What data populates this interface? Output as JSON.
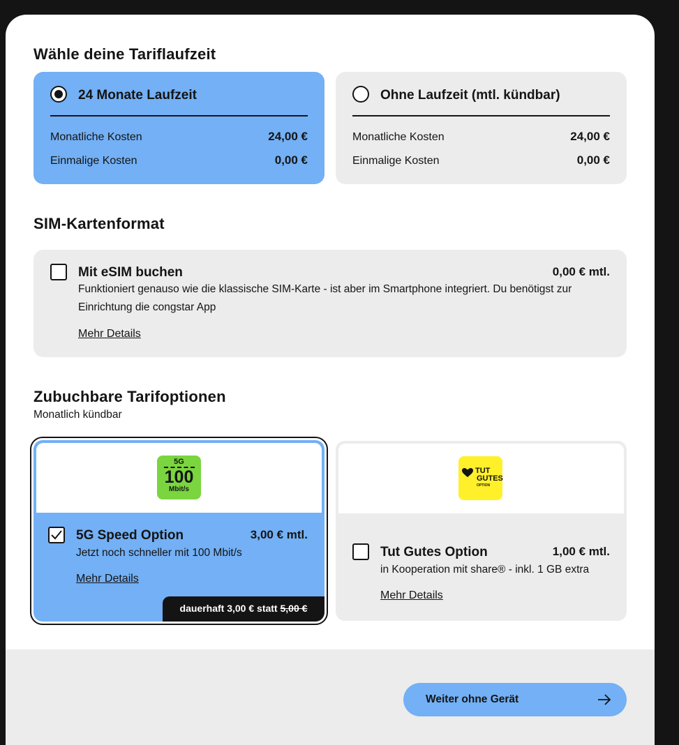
{
  "sections": {
    "duration_title": "Wähle deine Tariflaufzeit",
    "sim_title": "SIM-Kartenformat",
    "options_title": "Zubuchbare Tarifoptionen",
    "options_subtitle": "Monatlich kündbar"
  },
  "durations": [
    {
      "title": "24 Monate Laufzeit",
      "selected": true,
      "monthly_label": "Monatliche Kosten",
      "monthly_value": "24,00 €",
      "once_label": "Einmalige Kosten",
      "once_value": "0,00 €"
    },
    {
      "title": "Ohne Laufzeit (mtl. kündbar)",
      "selected": false,
      "monthly_label": "Monatliche Kosten",
      "monthly_value": "24,00 €",
      "once_label": "Einmalige Kosten",
      "once_value": "0,00 €"
    }
  ],
  "esim": {
    "title": "Mit eSIM buchen",
    "price": "0,00 € mtl.",
    "checked": false,
    "description_line1": "Funktioniert genauso wie die klassische SIM-Karte - ist aber im Smartphone integriert. Du benötigst zur",
    "description_line2": "Einrichtung die congstar App",
    "details_link": "Mehr Details"
  },
  "options": [
    {
      "title": "5G Speed Option",
      "price": "3,00 € mtl.",
      "checked": true,
      "description": "Jetzt noch schneller mit 100 Mbit/s",
      "details_link": "Mehr Details",
      "logo_top": "5G",
      "logo_number": "100",
      "logo_unit": "Mbit/s",
      "promo_prefix": "dauerhaft 3,00 € statt",
      "promo_old": "5,00 €"
    },
    {
      "title": "Tut Gutes Option",
      "price": "1,00 € mtl.",
      "checked": false,
      "description": "in Kooperation mit share® - inkl. 1 GB extra",
      "details_link": "Mehr Details",
      "logo_line1": "TUT",
      "logo_line2": "GUTES",
      "logo_line3": "OPTION"
    }
  ],
  "footer": {
    "next_button": "Weiter ohne Gerät"
  },
  "colors": {
    "selected_blue": "#73b0f5",
    "card_grey": "#ececec",
    "logo_green": "#7ad53f",
    "logo_yellow": "#fff02a",
    "dark": "#141414"
  }
}
